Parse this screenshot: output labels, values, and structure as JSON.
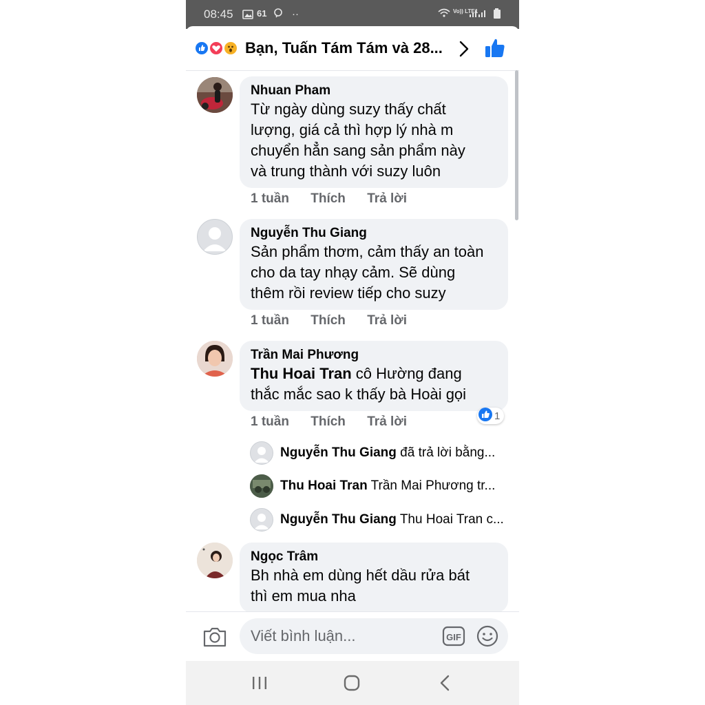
{
  "status_bar": {
    "time": "08:45",
    "notif_count": "61",
    "net": "Vo)) LTE1"
  },
  "header": {
    "title": "Bạn, Tuấn Tám Tám và 28..."
  },
  "comments": [
    {
      "author": "Nhuan Pham",
      "lines": [
        "Từ ngày dùng suzy thấy chất",
        "lượng, giá cả thì hợp lý nhà m",
        "chuyển hẳn sang sản phẩm này",
        "và trung thành với suzy luôn"
      ],
      "time": "1 tuần",
      "like": "Thích",
      "reply": "Trả lời"
    },
    {
      "author": "Nguyễn Thu Giang",
      "lines": [
        "Sản phẩm thơm, cảm thấy an toàn",
        "cho da tay nhạy cảm. Sẽ dùng",
        "thêm rồi review tiếp cho suzy"
      ],
      "time": "1 tuần",
      "like": "Thích",
      "reply": "Trả lời"
    },
    {
      "author": "Trần Mai Phương",
      "tag": "Thu Hoai Tran",
      "line1_rest": " cô Hường đang",
      "line2": "thắc mắc sao k thấy bà Hoài gọi",
      "time": "1 tuần",
      "like": "Thích",
      "reply": "Trả lời",
      "reaction_count": "1",
      "replies": [
        {
          "name": "Nguyễn Thu Giang",
          "snippet": " đã trả lời bằng..."
        },
        {
          "name": "Thu Hoai Tran",
          "snippet": " Trần Mai Phương tr..."
        },
        {
          "name": "Nguyễn Thu Giang",
          "snippet": " Thu Hoai Tran c..."
        }
      ]
    },
    {
      "author": "Ngọc Trâm",
      "lines": [
        "Bh nhà em dùng hết dầu rửa bát",
        "thì em mua nha"
      ]
    }
  ],
  "composer": {
    "placeholder": "Viết bình luận...",
    "gif_label": "GIF"
  },
  "colors": {
    "accent": "#1877f2",
    "bubble": "#f0f2f5",
    "secondary_text": "#65676b",
    "status_bar": "#5a5a5a"
  },
  "icons": [
    "like-reaction-icon",
    "love-reaction-icon",
    "wow-reaction-icon",
    "chevron-right-icon",
    "thumbs-up-icon",
    "camera-icon",
    "gif-icon",
    "emoji-icon",
    "recent-apps-icon",
    "home-icon",
    "back-icon"
  ]
}
